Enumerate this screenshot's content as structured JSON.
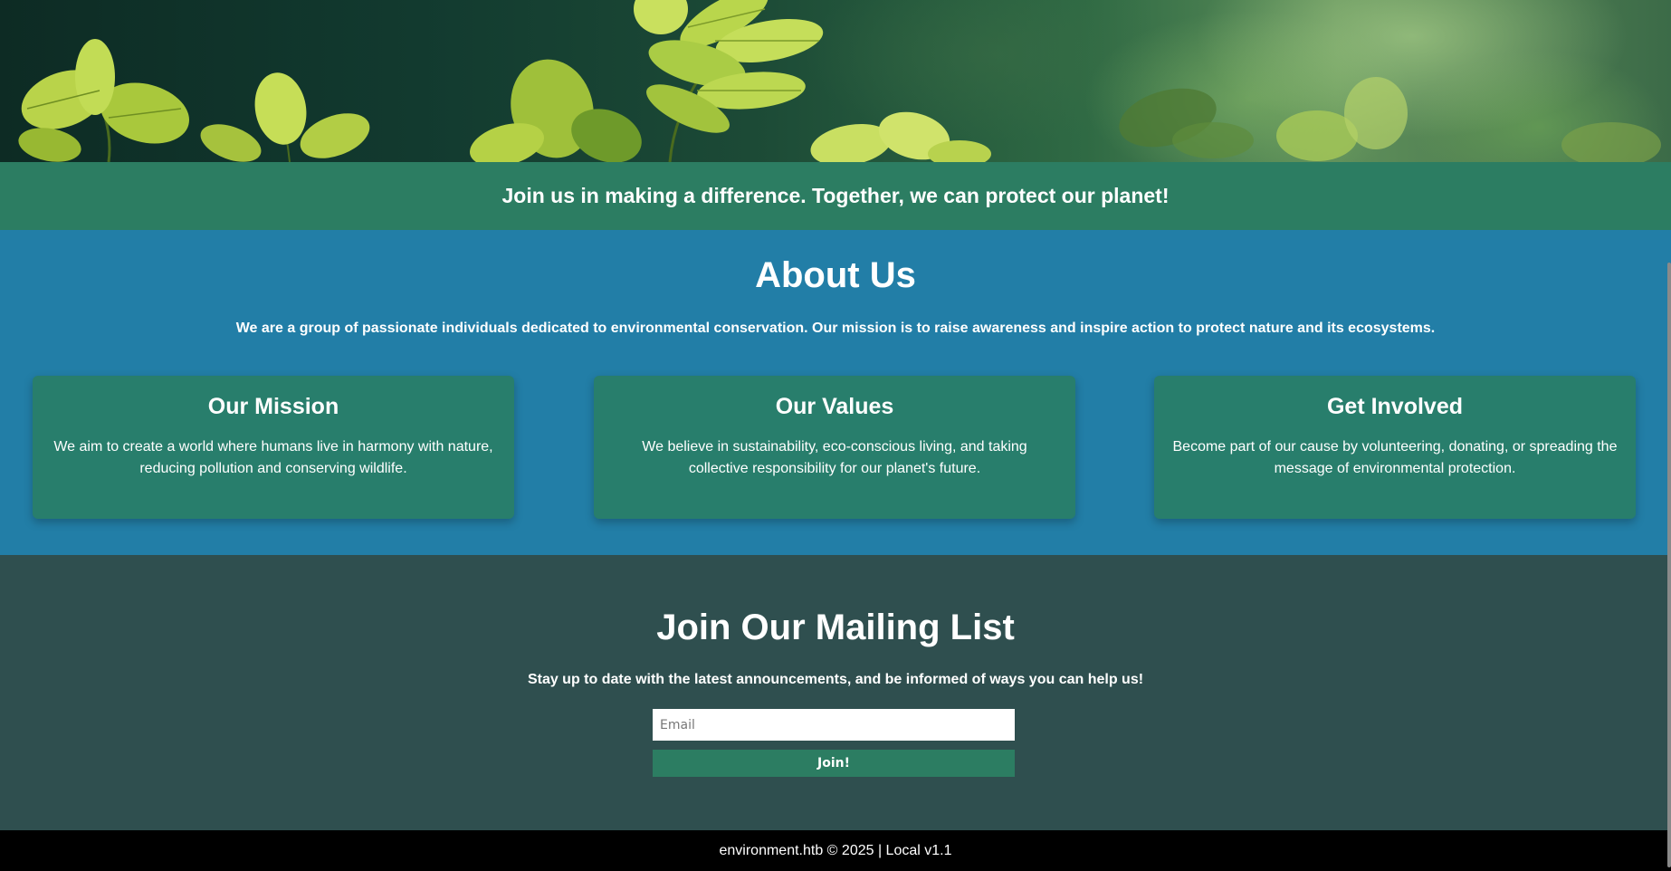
{
  "hero": {
    "image_name": "leaves-forest-banner"
  },
  "tagline": {
    "text": "Join us in making a difference. Together, we can protect our planet!"
  },
  "about": {
    "title": "About Us",
    "description": "We are a group of passionate individuals dedicated to environmental conservation. Our mission is to raise awareness and inspire action to protect nature and its ecosystems.",
    "cards": [
      {
        "title": "Our Mission",
        "body": "We aim to create a world where humans live in harmony with nature, reducing pollution and conserving wildlife."
      },
      {
        "title": "Our Values",
        "body": "We believe in sustainability, eco-conscious living, and taking collective responsibility for our planet's future."
      },
      {
        "title": "Get Involved",
        "body": "Become part of our cause by volunteering, donating, or spreading the message of environmental protection."
      }
    ]
  },
  "mailing": {
    "title": "Join Our Mailing List",
    "subtitle": "Stay up to date with the latest announcements, and be informed of ways you can help us!",
    "email_placeholder": "Email",
    "email_value": "",
    "join_label": "Join!"
  },
  "footer": {
    "text": "environment.htb © 2025 | Local v1.1"
  },
  "colors": {
    "tagline_bg": "#2c7d62",
    "about_bg": "#227ea7",
    "card_bg": "#287e6c",
    "mailing_bg": "#2f4f4f",
    "footer_bg": "#000000",
    "button_bg": "#2c7d62"
  }
}
